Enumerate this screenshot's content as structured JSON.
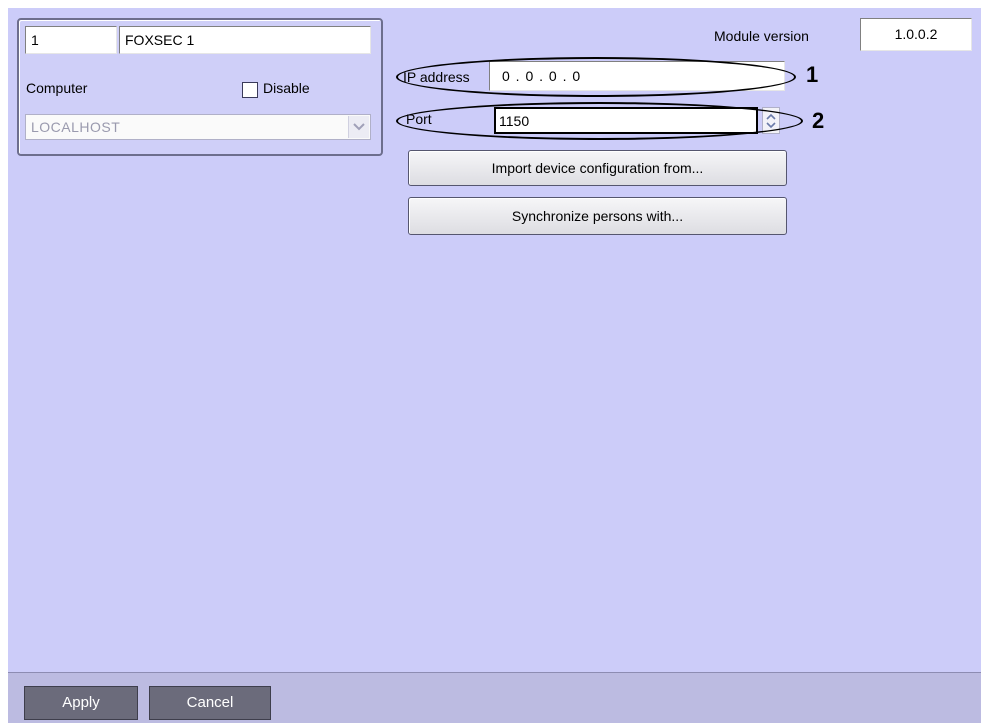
{
  "left_panel": {
    "id_value": "1",
    "name_value": "FOXSEC 1",
    "computer_label": "Computer",
    "disable_label": "Disable",
    "computer_select_value": "LOCALHOST"
  },
  "module": {
    "version_label": "Module version",
    "version_value": "1.0.0.2"
  },
  "settings": {
    "ip_label": "IP address",
    "ip_value": "0 . 0 . 0 . 0",
    "port_label": "Port",
    "port_value": "1150"
  },
  "actions": {
    "import_label": "Import device configuration from...",
    "sync_label": "Synchronize persons with..."
  },
  "annotations": {
    "marker_1": "1",
    "marker_2": "2"
  },
  "footer": {
    "apply_label": "Apply",
    "cancel_label": "Cancel"
  },
  "icons": {
    "combo_arrow": "chevron-down-icon",
    "spinner": "spinner-icon"
  }
}
